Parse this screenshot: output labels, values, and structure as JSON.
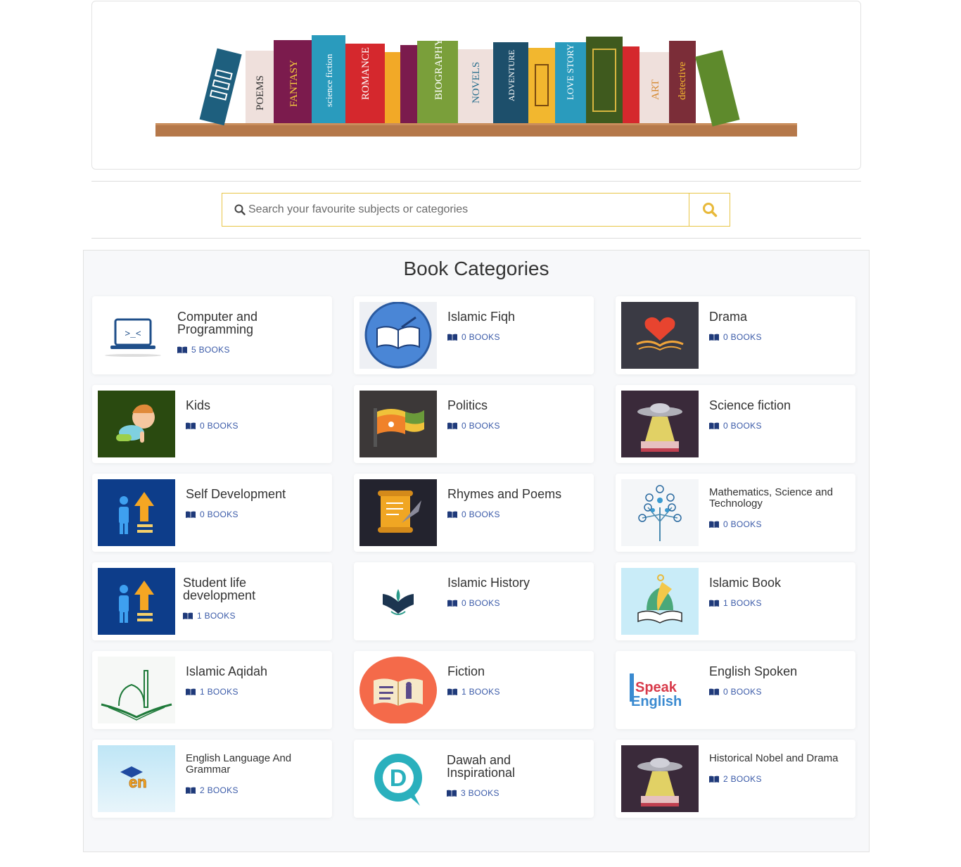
{
  "search": {
    "placeholder": "Search your favourite subjects or categories"
  },
  "banner": {
    "spines": [
      "POEMS",
      "FANTASY",
      "science fiction",
      "ROMANCE",
      "BIOGRAPHY",
      "NOVELS",
      "ADVENTURE",
      "LOVE STORY",
      "ART",
      "detective"
    ]
  },
  "categories": {
    "title": "Book Categories",
    "items": [
      {
        "name": "Computer and Programming",
        "count": "5 BOOKS"
      },
      {
        "name": "Islamic Fiqh",
        "count": "0 BOOKS"
      },
      {
        "name": "Drama",
        "count": "0 BOOKS"
      },
      {
        "name": "Kids",
        "count": "0 BOOKS"
      },
      {
        "name": "Politics",
        "count": "0 BOOKS"
      },
      {
        "name": "Science fiction",
        "count": "0 BOOKS"
      },
      {
        "name": "Self Development",
        "count": "0 BOOKS"
      },
      {
        "name": "Rhymes and Poems",
        "count": "0 BOOKS"
      },
      {
        "name": "Mathematics, Science and Technology",
        "count": "0 BOOKS"
      },
      {
        "name": "Student life development",
        "count": "1 BOOKS"
      },
      {
        "name": "Islamic History",
        "count": "0 BOOKS"
      },
      {
        "name": "Islamic Book",
        "count": "1 BOOKS"
      },
      {
        "name": "Islamic Aqidah",
        "count": "1 BOOKS"
      },
      {
        "name": "Fiction",
        "count": "1 BOOKS"
      },
      {
        "name": "English Spoken",
        "count": "0 BOOKS"
      },
      {
        "name": "English Language And Grammar",
        "count": "2 BOOKS"
      },
      {
        "name": "Dawah and Inspirational",
        "count": "3 BOOKS"
      },
      {
        "name": "Historical Nobel and Drama",
        "count": "2 BOOKS"
      }
    ],
    "thumb_text": {
      "speak": "Speak",
      "english": "English",
      "en": "en",
      "d": "D"
    }
  },
  "colors": {
    "accent": "#e8c547",
    "count_blue": "#3a5aa8",
    "panel_bg": "#f7f8fa"
  }
}
